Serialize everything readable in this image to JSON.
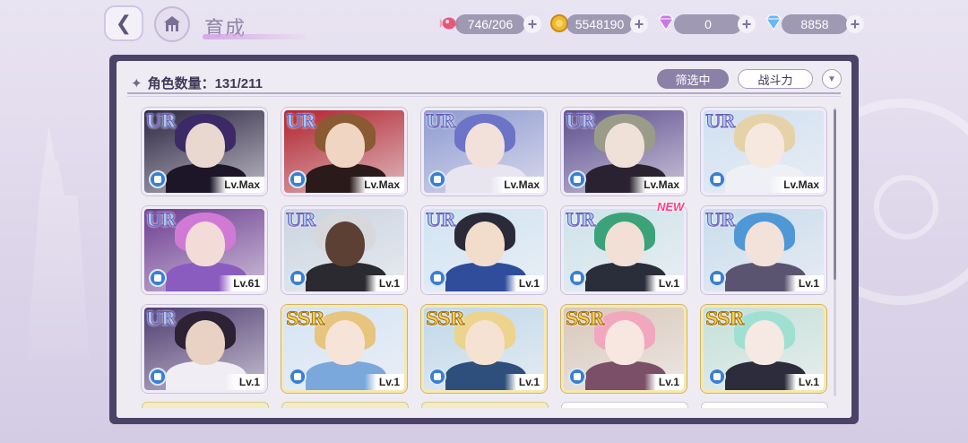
{
  "header": {
    "title": "育成",
    "resources": [
      {
        "name": "candy",
        "icon": "candy-icon",
        "value": "746/206",
        "color": "#e8567a"
      },
      {
        "name": "coin",
        "icon": "gold-coin-icon",
        "value": "5548190",
        "color": "#f1b92c"
      },
      {
        "name": "pink-diamond",
        "icon": "pink-diamond-icon",
        "value": "0",
        "color": "#c978e6"
      },
      {
        "name": "blue-diamond",
        "icon": "blue-diamond-icon",
        "value": "8858",
        "color": "#69b8f2"
      }
    ]
  },
  "panel": {
    "count_label": "角色数量：131/211",
    "filter_label": "筛选中",
    "sort_label": "战斗力",
    "new_label": "NEW"
  },
  "cards": [
    {
      "rarity": "UR",
      "level": "Lv.Max",
      "bg": "#2b2540",
      "hair": "#3b2a66",
      "skin": "#e9d8d0",
      "body": "#1c1628",
      "frame": "purple"
    },
    {
      "rarity": "UR",
      "level": "Lv.Max",
      "bg": "#b0232d",
      "hair": "#8a5a32",
      "skin": "#f0d6c2",
      "body": "#2a1a1a",
      "frame": "purple"
    },
    {
      "rarity": "UR",
      "level": "Lv.Max",
      "bg": "#8e9ad0",
      "hair": "#6d73c7",
      "skin": "#f2e0da",
      "body": "#e8e4f0",
      "frame": "purple"
    },
    {
      "rarity": "UR",
      "level": "Lv.Max",
      "bg": "#5c4c8e",
      "hair": "#9a9c8a",
      "skin": "#efe0d8",
      "body": "#2a2230",
      "frame": "purple"
    },
    {
      "rarity": "UR",
      "level": "Lv.Max",
      "bg": "#cfe0f0",
      "hair": "#e6d2a8",
      "skin": "#f6e8de",
      "body": "#eef0f6",
      "frame": "purple"
    },
    {
      "rarity": "UR",
      "level": "Lv.61",
      "bg": "#6c3c90",
      "hair": "#d07ad6",
      "skin": "#f3dcd8",
      "body": "#8a5cc0",
      "frame": "purple"
    },
    {
      "rarity": "UR",
      "level": "Lv.1",
      "bg": "#c9d4e0",
      "hair": "#d6d8dc",
      "skin": "#5c4034",
      "body": "#2a2a30",
      "frame": "purple"
    },
    {
      "rarity": "UR",
      "level": "Lv.1",
      "bg": "#cfe4f2",
      "hair": "#2a2a38",
      "skin": "#f2dccc",
      "body": "#2f4d9a",
      "frame": "purple"
    },
    {
      "rarity": "UR",
      "level": "Lv.1",
      "bg": "#cde3ea",
      "hair": "#3ca27a",
      "skin": "#f2e0d6",
      "body": "#2a2d3a",
      "frame": "purple"
    },
    {
      "rarity": "UR",
      "level": "Lv.1",
      "bg": "#c7dcec",
      "hair": "#4f98d6",
      "skin": "#f3e2da",
      "body": "#5a5470",
      "frame": "purple"
    },
    {
      "rarity": "UR",
      "level": "Lv.1",
      "bg": "#4e3c70",
      "hair": "#2c2234",
      "skin": "#e9d2c4",
      "body": "#f0eef4",
      "frame": "purple"
    },
    {
      "rarity": "SSR",
      "level": "Lv.1",
      "bg": "#d4e4f4",
      "hair": "#e7c57e",
      "skin": "#f6e4d8",
      "body": "#7aa8dc",
      "frame": "gold"
    },
    {
      "rarity": "SSR",
      "level": "Lv.1",
      "bg": "#bfd8e8",
      "hair": "#ecd38e",
      "skin": "#f5e2d2",
      "body": "#2e4f7c",
      "frame": "gold"
    },
    {
      "rarity": "SSR",
      "level": "Lv.1",
      "bg": "#d8c8b8",
      "hair": "#f1a8be",
      "skin": "#f8e6e0",
      "body": "#7c4f68",
      "frame": "gold"
    },
    {
      "rarity": "SSR",
      "level": "Lv.1",
      "bg": "#c4e0d8",
      "hair": "#9fe0d2",
      "skin": "#f6e8e2",
      "body": "#2c2c3c",
      "frame": "gold"
    }
  ]
}
